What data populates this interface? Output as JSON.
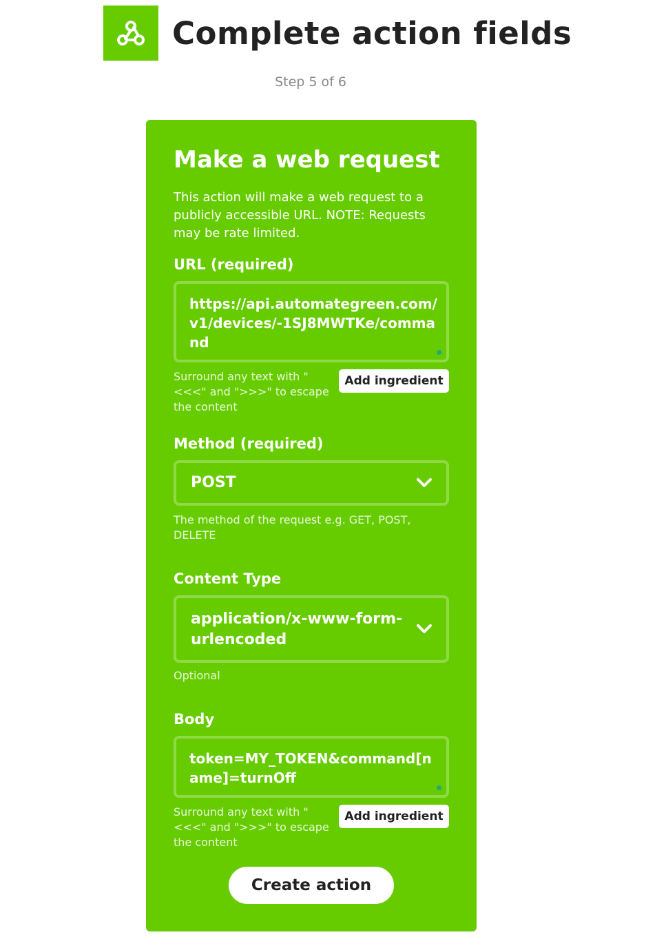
{
  "header": {
    "logo_icon": "webhooks-icon",
    "title": "Complete action fields",
    "step": "Step 5 of 6"
  },
  "card": {
    "background": "#66cc00",
    "title": "Make a web request",
    "description": "This action will make a web request to a publicly accessible URL. NOTE: Requests may be rate limited.",
    "url": {
      "label": "URL (required)",
      "value": "https://api.automategreen.com/v1/devices/-1SJ8MWTKe/command",
      "helper": "Surround any text with \"<<<\" and \">>>\" to escape the content",
      "button": "Add ingredient"
    },
    "method": {
      "label": "Method (required)",
      "value": "POST",
      "helper": "The method of the request e.g. GET, POST, DELETE"
    },
    "content_type": {
      "label": "Content Type",
      "value": "application/x-www-form-urlencoded",
      "helper": "Optional"
    },
    "body": {
      "label": "Body",
      "value": "token=MY_TOKEN&command[name]=turnOff",
      "helper": "Surround any text with \"<<<\" and \">>>\" to escape the content",
      "button": "Add ingredient"
    },
    "submit": "Create action"
  }
}
